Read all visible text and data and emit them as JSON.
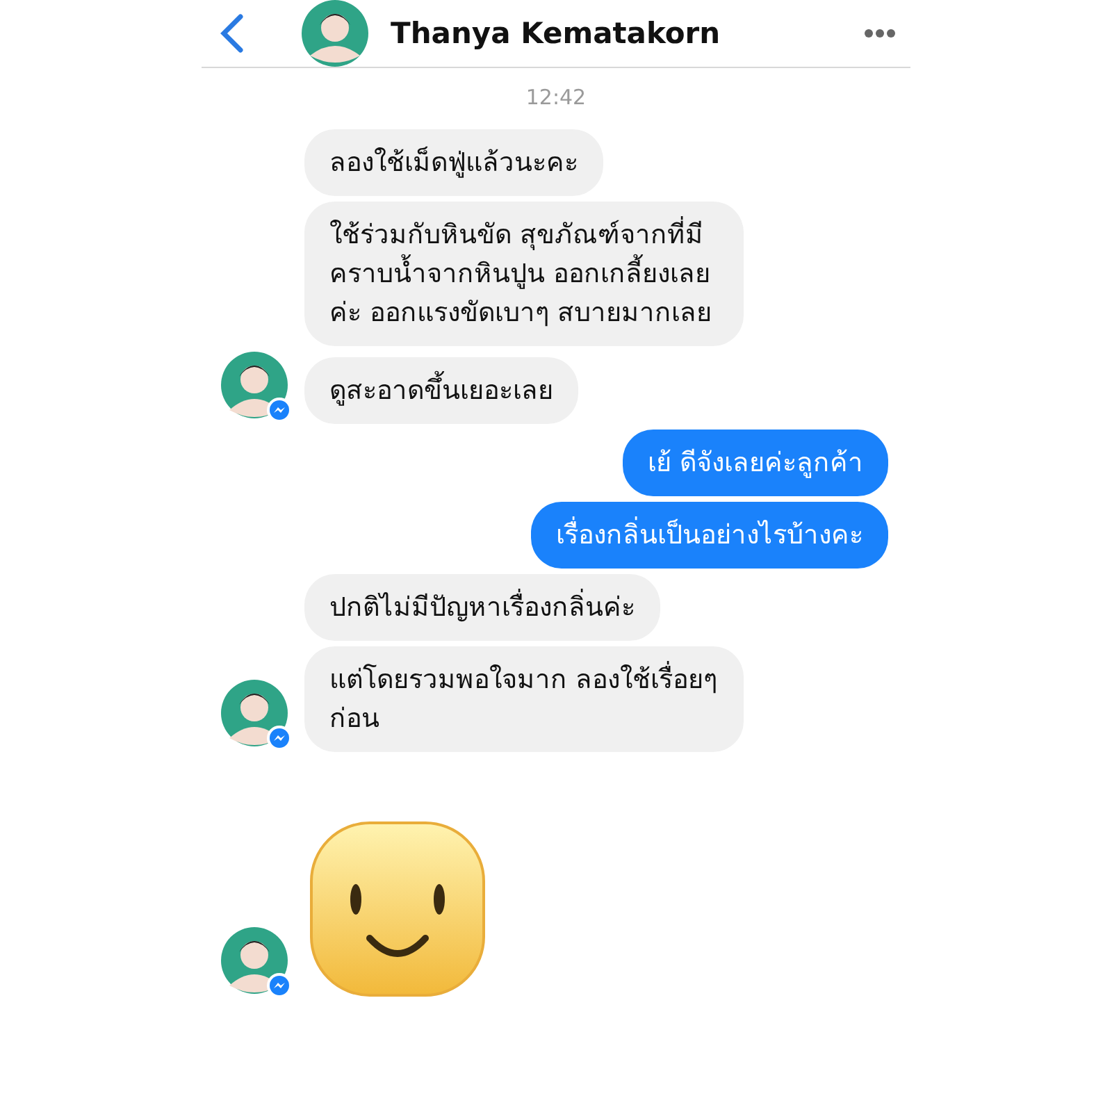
{
  "header": {
    "title": "Thanya Kematakorn"
  },
  "timestamp": "12:42",
  "messages": [
    {
      "kind": "text",
      "outgoing": false,
      "text": "ลองใช้เม็ดฟู่แล้วนะคะ",
      "avatar": false
    },
    {
      "kind": "text",
      "outgoing": false,
      "text": "ใช้ร่วมกับหินขัด สุขภัณฑ์จากที่มีคราบน้ำจากหินปูน ออกเกลี้ยงเลยค่ะ ออกแรงขัดเบาๆ สบายมากเลย",
      "avatar": false
    },
    {
      "kind": "text",
      "outgoing": false,
      "text": "ดูสะอาดขึ้นเยอะเลย",
      "avatar": true
    },
    {
      "kind": "text",
      "outgoing": true,
      "text": "เย้ ดีจังเลยค่ะลูกค้า"
    },
    {
      "kind": "text",
      "outgoing": true,
      "text": "เรื่องกลิ่นเป็นอย่างไรบ้างคะ"
    },
    {
      "kind": "text",
      "outgoing": false,
      "text": "ปกติไม่มีปัญหาเรื่องกลิ่นค่ะ",
      "avatar": false
    },
    {
      "kind": "text",
      "outgoing": false,
      "text": "แต่โดยรวมพอใจมาก ลองใช้เรื่อยๆก่อน",
      "avatar": true
    },
    {
      "kind": "sticker",
      "outgoing": false,
      "avatar": true
    }
  ]
}
